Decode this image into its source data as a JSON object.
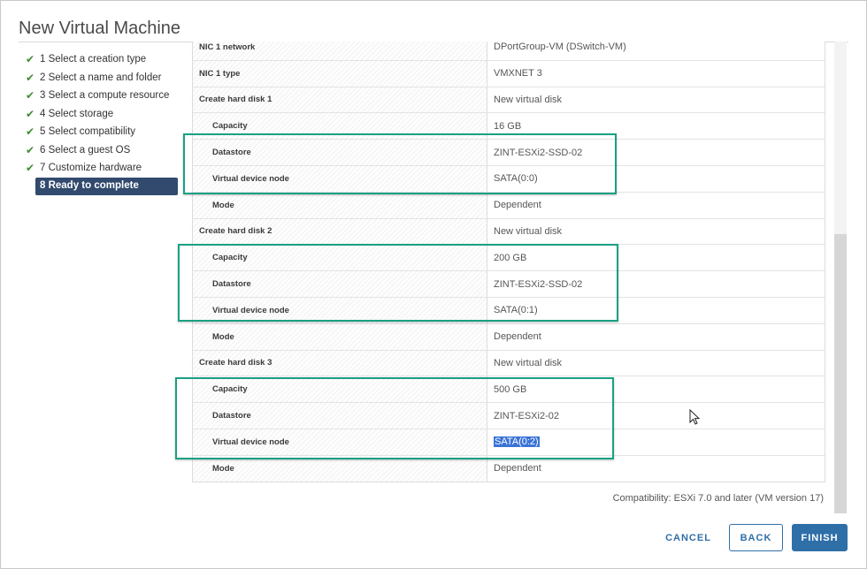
{
  "dialog": {
    "title": "New Virtual Machine"
  },
  "steps": [
    {
      "label": "1 Select a creation type",
      "done": true
    },
    {
      "label": "2 Select a name and folder",
      "done": true
    },
    {
      "label": "3 Select a compute resource",
      "done": true
    },
    {
      "label": "4 Select storage",
      "done": true
    },
    {
      "label": "5 Select compatibility",
      "done": true
    },
    {
      "label": "6 Select a guest OS",
      "done": true
    },
    {
      "label": "7 Customize hardware",
      "done": true
    },
    {
      "label": "8 Ready to complete",
      "done": false,
      "active": true
    }
  ],
  "rows": [
    {
      "label": "NIC 1 network",
      "value": "DPortGroup-VM (DSwitch-VM)",
      "level": 0
    },
    {
      "label": "NIC 1 type",
      "value": "VMXNET 3",
      "level": 0
    },
    {
      "label": "Create hard disk 1",
      "value": "New virtual disk",
      "level": 0
    },
    {
      "label": "Capacity",
      "value": "16 GB",
      "level": 1
    },
    {
      "label": "Datastore",
      "value": "ZINT-ESXi2-SSD-02",
      "level": 1
    },
    {
      "label": "Virtual device node",
      "value": "SATA(0:0)",
      "level": 1
    },
    {
      "label": "Mode",
      "value": "Dependent",
      "level": 1
    },
    {
      "label": "Create hard disk 2",
      "value": "New virtual disk",
      "level": 0
    },
    {
      "label": "Capacity",
      "value": "200 GB",
      "level": 1
    },
    {
      "label": "Datastore",
      "value": "ZINT-ESXi2-SSD-02",
      "level": 1
    },
    {
      "label": "Virtual device node",
      "value": "SATA(0:1)",
      "level": 1
    },
    {
      "label": "Mode",
      "value": "Dependent",
      "level": 1
    },
    {
      "label": "Create hard disk 3",
      "value": "New virtual disk",
      "level": 0
    },
    {
      "label": "Capacity",
      "value": "500 GB",
      "level": 1
    },
    {
      "label": "Datastore",
      "value": "ZINT-ESXi2-02",
      "level": 1
    },
    {
      "label": "Virtual device node",
      "value": "SATA(0:2)",
      "level": 1,
      "selected": true
    },
    {
      "label": "Mode",
      "value": "Dependent",
      "level": 1
    }
  ],
  "footer": {
    "compatibility": "Compatibility: ESXi 7.0 and later (VM version 17)",
    "cancel_label": "CANCEL",
    "back_label": "BACK",
    "finish_label": "FINISH"
  },
  "colors": {
    "accent": "#2f6fa8",
    "active_step": "#314a6e",
    "check": "#3c8c2e",
    "highlight": "#1aa084",
    "selection": "#3a73d6"
  },
  "icons": {
    "step_done": "check-icon",
    "cursor": "mouse-pointer-icon"
  }
}
